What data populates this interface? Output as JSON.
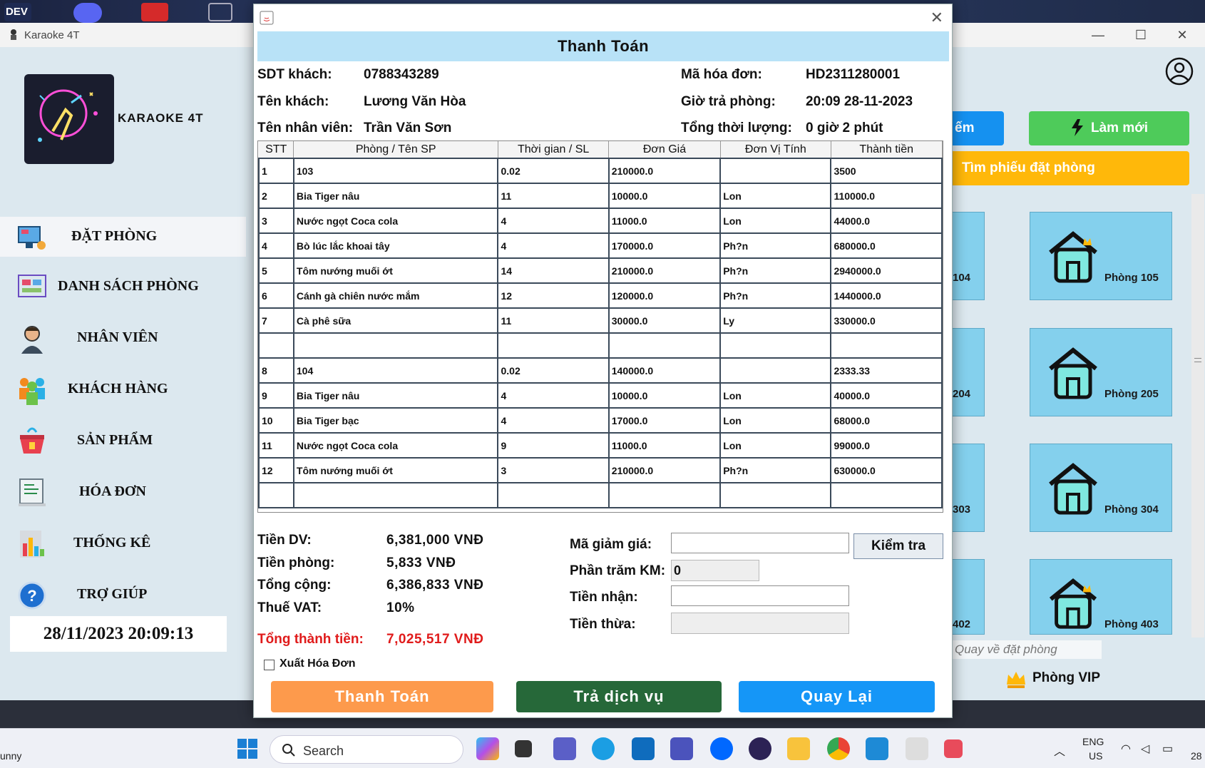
{
  "desktop": {
    "badge_text": "DEV"
  },
  "app": {
    "title": "Karaoke 4T",
    "brand": "KARAOKE 4T",
    "nav": [
      {
        "label": "ĐẶT PHÒNG",
        "icon": "booking-icon"
      },
      {
        "label": "DANH SÁCH PHÒNG",
        "icon": "room-list-icon"
      },
      {
        "label": "NHÂN VIÊN",
        "icon": "employee-icon"
      },
      {
        "label": "KHÁCH HÀNG",
        "icon": "customers-icon"
      },
      {
        "label": "SẢN PHẨM",
        "icon": "products-icon"
      },
      {
        "label": "HÓA ĐƠN",
        "icon": "invoice-icon"
      },
      {
        "label": "THỐNG KÊ",
        "icon": "statistics-icon"
      },
      {
        "label": "TRỢ GIÚP",
        "icon": "help-icon"
      }
    ],
    "clock": "28/11/2023 20:09:13",
    "right": {
      "search_partial": "ếm",
      "refresh_label": "Làm mới",
      "find_booking_label": "Tìm phiếu đặt phòng",
      "rooms_partial": [
        "104",
        "204",
        "303",
        "402"
      ],
      "rooms": [
        "Phòng 105",
        "Phòng 205",
        "Phòng 304",
        "Phòng 403"
      ],
      "back_placeholder": "Quay về đặt phòng",
      "vip_label": "Phòng VIP"
    }
  },
  "dialog": {
    "header": "Thanh Toán",
    "info": {
      "phone_label": "SDT khách:",
      "phone": "0788343289",
      "name_label": "Tên khách:",
      "name": "Lương Văn Hòa",
      "staff_label": "Tên nhân viên:",
      "staff": "Trần Văn Sơn",
      "invoice_label": "Mã hóa đơn:",
      "invoice": "HD2311280001",
      "checkout_label": "Giờ trả phòng:",
      "checkout": "20:09 28-11-2023",
      "duration_label": "Tổng thời lượng:",
      "duration": "0 giờ 2 phút"
    },
    "table": {
      "columns": [
        "STT",
        "Phòng / Tên SP",
        "Thời gian / SL",
        "Đơn Giá",
        "Đơn Vị Tính",
        "Thành tiền"
      ],
      "rows": [
        [
          "1",
          "103",
          "0.02",
          "210000.0",
          "",
          "3500"
        ],
        [
          "2",
          "Bia Tiger nâu",
          "11",
          "10000.0",
          "Lon",
          "110000.0"
        ],
        [
          "3",
          "Nước ngọt Coca cola",
          "4",
          "11000.0",
          "Lon",
          "44000.0"
        ],
        [
          "4",
          "Bò lúc lắc khoai tây",
          "4",
          "170000.0",
          "Ph?n",
          "680000.0"
        ],
        [
          "5",
          "Tôm nướng muối ớt",
          "14",
          "210000.0",
          "Ph?n",
          "2940000.0"
        ],
        [
          "6",
          "Cánh gà chiên nước mắm",
          "12",
          "120000.0",
          "Ph?n",
          "1440000.0"
        ],
        [
          "7",
          "Cà phê sữa",
          "11",
          "30000.0",
          "Ly",
          "330000.0"
        ],
        [
          "",
          "",
          "",
          "",
          "",
          ""
        ],
        [
          "8",
          "104",
          "0.02",
          "140000.0",
          "",
          "2333.33"
        ],
        [
          "9",
          "Bia Tiger nâu",
          "4",
          "10000.0",
          "Lon",
          "40000.0"
        ],
        [
          "10",
          "Bia Tiger bạc",
          "4",
          "17000.0",
          "Lon",
          "68000.0"
        ],
        [
          "11",
          "Nước ngọt Coca cola",
          "9",
          "11000.0",
          "Lon",
          "99000.0"
        ],
        [
          "12",
          "Tôm nướng muối ớt",
          "3",
          "210000.0",
          "Ph?n",
          "630000.0"
        ],
        [
          "",
          "",
          "",
          "",
          "",
          ""
        ]
      ]
    },
    "summary": {
      "service_label": "Tiền DV:",
      "service": "6,381,000 VNĐ",
      "room_label": "Tiền phòng:",
      "room": "5,833 VNĐ",
      "total_label": "Tổng cộng:",
      "total": "6,386,833 VNĐ",
      "vat_label": "Thuế VAT:",
      "vat": "10%",
      "grand_label": "Tổng thành tiền:",
      "grand": "7,025,517 VNĐ"
    },
    "discount": {
      "code_label": "Mã giảm giá:",
      "code_value": "",
      "check_label": "Kiểm tra",
      "percent_label": "Phần trăm KM:",
      "percent_value": "0",
      "received_label": "Tiền nhận:",
      "received_value": "",
      "change_label": "Tiền thừa:",
      "change_value": ""
    },
    "export_label": "Xuất Hóa Đơn",
    "buttons": {
      "pay": "Thanh Toán",
      "return_service": "Trả dịch vụ",
      "back": "Quay Lại"
    },
    "colors": {
      "pay": "#fd9a4c",
      "return_service": "#266839",
      "back": "#1596f7",
      "accent_red": "#e01b1b"
    }
  },
  "taskbar": {
    "search_placeholder": "Search",
    "left_text": "unny",
    "lang": "ENG",
    "region": "US",
    "clock_partial": "28"
  }
}
